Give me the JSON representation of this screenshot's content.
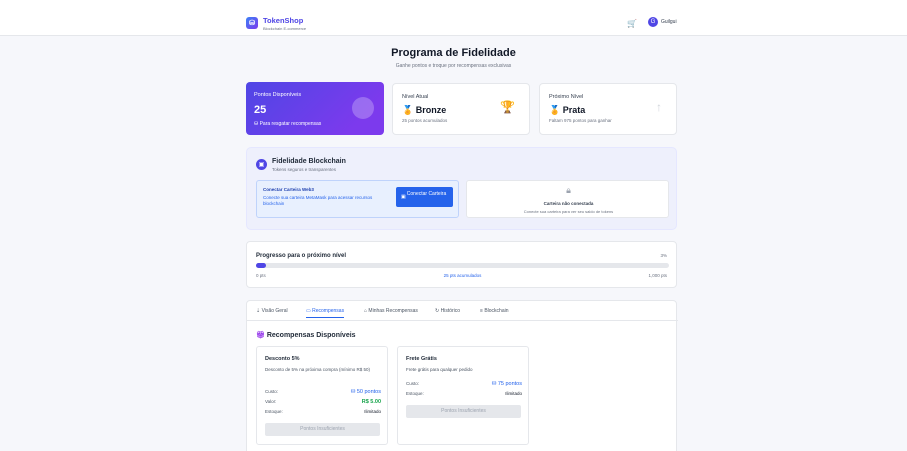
{
  "header": {
    "brand": "TokenShop",
    "brand_sub": "Blockchain E-commerce",
    "user": "Guilgui",
    "cart_icon": "cart-icon",
    "avatar_initial": "G"
  },
  "page": {
    "title": "Programa de Fidelidade",
    "subtitle": "Ganhe pontos e troque por recompensas exclusivas"
  },
  "stats": {
    "points": {
      "label": "Pontos Disponíveis",
      "value": "25",
      "note": "Para resgatar recompensas"
    },
    "current": {
      "label": "Nível Atual",
      "value": "Bronze",
      "note": "25 pontos acumulados"
    },
    "next": {
      "label": "Próximo Nível",
      "value": "Prata",
      "note": "Faltam 975 pontos para ganhar"
    }
  },
  "blockchain": {
    "title": "Fidelidade Blockchain",
    "subtitle": "Tokens seguros e transparentes",
    "connect_title": "Conectar Carteira Web3",
    "connect_desc": "Conecte sua carteira MetaMask para acessar recursos blockchain",
    "connect_button": "Conectar Carteira",
    "status_title": "Carteira não conectada",
    "status_desc": "Conecte sua carteira para ver seu saldo de tokens"
  },
  "progress": {
    "title": "Progresso para o próximo nível",
    "percent": "3%",
    "fraction": 0.025,
    "min": "0 pts",
    "current": "25 pts acumulados",
    "max": "1,000 pts"
  },
  "tabs": [
    "Visão Geral",
    "Recompensas",
    "Minhas Recompensas",
    "Histórico",
    "Blockchain"
  ],
  "rewards": {
    "title": "Recompensas Disponíveis",
    "items": [
      {
        "title": "Desconto 5%",
        "desc": "Desconto de 5% na próxima compra (mínimo R$ 50)",
        "cost_label": "Custo:",
        "cost": "50 pontos",
        "value_label": "Valor:",
        "value": "R$ 5.00",
        "stock_label": "Estoque:",
        "stock": "Ilimitado",
        "button": "Pontos Insuficientes"
      },
      {
        "title": "Frete Grátis",
        "desc": "Frete grátis para qualquer pedido",
        "cost_label": "Custo:",
        "cost": "75 pontos",
        "stock_label": "Estoque:",
        "stock": "Ilimitado",
        "button": "Pontos Insuficientes"
      }
    ]
  }
}
